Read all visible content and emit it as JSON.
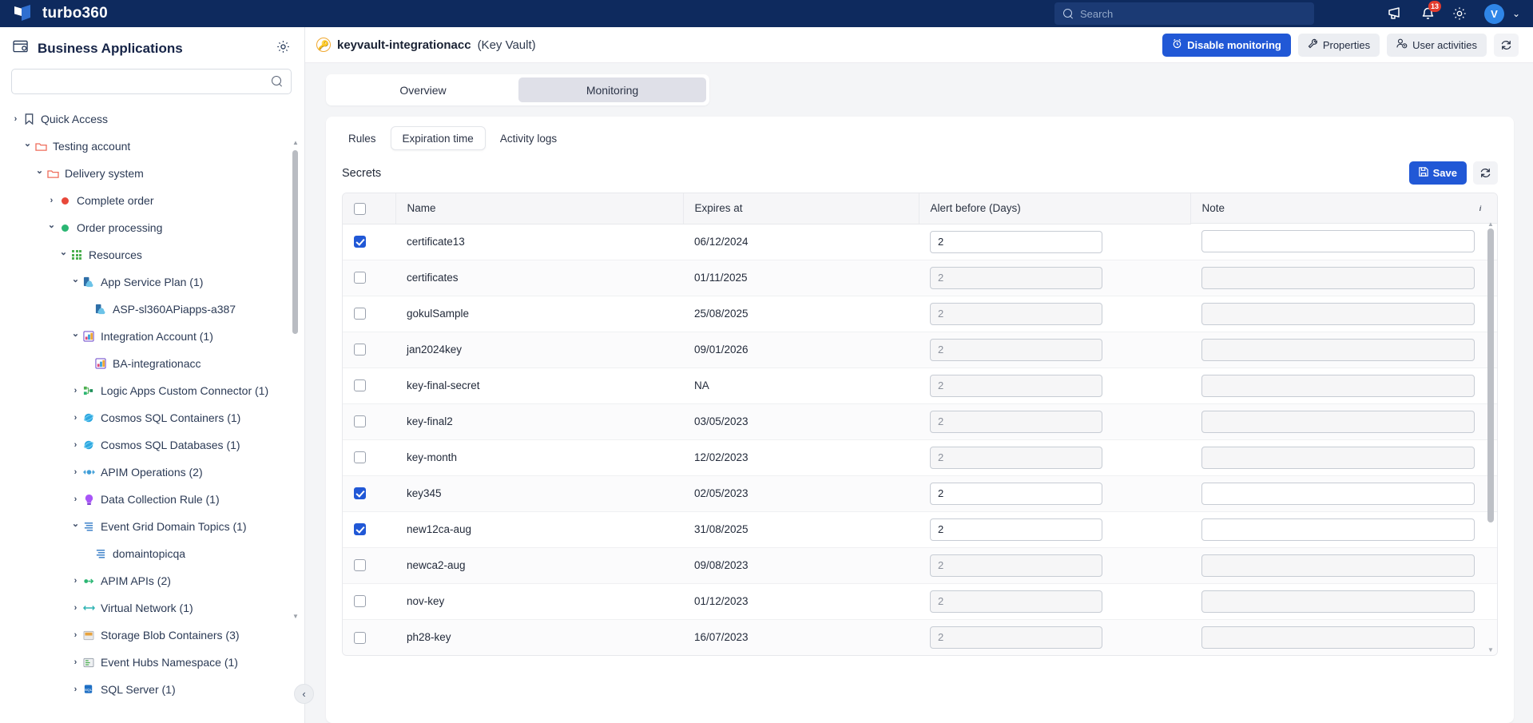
{
  "topbar": {
    "brand": "turbo360",
    "search_placeholder": "Search",
    "icons": {
      "announcement": "megaphone-icon",
      "notifications": "bell-icon",
      "settings": "gear-icon"
    },
    "notification_count": "13",
    "avatar_initial": "V",
    "avatar_chevron": "⌄"
  },
  "sidebar": {
    "title": "Business Applications",
    "search_placeholder": "",
    "search_value": "",
    "tree": [
      {
        "label": "Quick Access",
        "indent": 0,
        "arrow": "closed",
        "icon": "bookmark",
        "color": "#3c4a63"
      },
      {
        "label": "Testing account",
        "indent": 1,
        "arrow": "open",
        "icon": "folder",
        "color": "#ef6c5a"
      },
      {
        "label": "Delivery system",
        "indent": 2,
        "arrow": "open",
        "icon": "folder",
        "color": "#ef6c5a"
      },
      {
        "label": "Complete order",
        "indent": 3,
        "arrow": "closed",
        "icon": "dot",
        "color": "#e8483a"
      },
      {
        "label": "Order processing",
        "indent": 3,
        "arrow": "open",
        "icon": "dot",
        "color": "#2bb673"
      },
      {
        "label": "Resources",
        "indent": 4,
        "arrow": "open",
        "icon": "grid",
        "color": "#4caf50"
      },
      {
        "label": "App Service Plan (1)",
        "indent": 5,
        "arrow": "open",
        "icon": "appservice",
        "color": "#3f9ed8"
      },
      {
        "label": "ASP-sl360APiapps-a387",
        "indent": 6,
        "arrow": "none",
        "icon": "appservice",
        "color": "#3f9ed8"
      },
      {
        "label": "Integration Account (1)",
        "indent": 5,
        "arrow": "open",
        "icon": "intacct",
        "color": "#8a64d6"
      },
      {
        "label": "BA-integrationacc",
        "indent": 6,
        "arrow": "none",
        "icon": "intacct",
        "color": "#8a64d6"
      },
      {
        "label": "Logic Apps Custom Connector (1)",
        "indent": 5,
        "arrow": "closed",
        "icon": "connector",
        "color": "#4caf50"
      },
      {
        "label": "Cosmos SQL Containers (1)",
        "indent": 5,
        "arrow": "closed",
        "icon": "cosmos",
        "color": "#2fa8e0"
      },
      {
        "label": "Cosmos SQL Databases (1)",
        "indent": 5,
        "arrow": "closed",
        "icon": "cosmos",
        "color": "#2fa8e0"
      },
      {
        "label": "APIM Operations (2)",
        "indent": 5,
        "arrow": "closed",
        "icon": "apim",
        "color": "#3f9ed8"
      },
      {
        "label": "Data Collection Rule (1)",
        "indent": 5,
        "arrow": "closed",
        "icon": "bulb",
        "color": "#a855f7"
      },
      {
        "label": "Event Grid Domain Topics (1)",
        "indent": 5,
        "arrow": "open",
        "icon": "eventgrid",
        "color": "#2f78c4"
      },
      {
        "label": "domaintopicqa",
        "indent": 6,
        "arrow": "none",
        "icon": "eventgrid",
        "color": "#2f78c4"
      },
      {
        "label": "APIM APIs (2)",
        "indent": 5,
        "arrow": "closed",
        "icon": "apis",
        "color": "#2bb673"
      },
      {
        "label": "Virtual Network (1)",
        "indent": 5,
        "arrow": "closed",
        "icon": "vnet",
        "color": "#2fb3b3"
      },
      {
        "label": "Storage Blob Containers (3)",
        "indent": 5,
        "arrow": "closed",
        "icon": "blob",
        "color": "#e8a33d"
      },
      {
        "label": "Event Hubs Namespace (1)",
        "indent": 5,
        "arrow": "closed",
        "icon": "eventhubs",
        "color": "#4caf50"
      },
      {
        "label": "SQL Server (1)",
        "indent": 5,
        "arrow": "closed",
        "icon": "sqlserver",
        "color": "#1e6fc4"
      }
    ],
    "collapse_chevron": "‹"
  },
  "page": {
    "title": "keyvault-integrationacc",
    "subtitle": "(Key Vault)",
    "actions": {
      "disable_monitoring": "Disable monitoring",
      "properties": "Properties",
      "user_activities": "User activities",
      "refresh": "refresh-icon"
    }
  },
  "tabs": {
    "items": [
      {
        "label": "Overview",
        "active": false
      },
      {
        "label": "Monitoring",
        "active": true
      }
    ]
  },
  "subtabs": {
    "items": [
      {
        "label": "Rules",
        "active": false
      },
      {
        "label": "Expiration time",
        "active": true
      },
      {
        "label": "Activity logs",
        "active": false
      }
    ]
  },
  "section": {
    "title": "Secrets",
    "save_label": "Save",
    "refresh_label": "refresh-icon"
  },
  "table": {
    "columns": [
      "",
      "Name",
      "Expires at",
      "Alert before (Days)",
      "Note"
    ],
    "note_info_icon": "info-icon",
    "rows": [
      {
        "checked": true,
        "name": "certificate13",
        "expires": "06/12/2024",
        "alert": "2",
        "note": ""
      },
      {
        "checked": false,
        "name": "certificates",
        "expires": "01/11/2025",
        "alert": "2",
        "note": ""
      },
      {
        "checked": false,
        "name": "gokulSample",
        "expires": "25/08/2025",
        "alert": "2",
        "note": ""
      },
      {
        "checked": false,
        "name": "jan2024key",
        "expires": "09/01/2026",
        "alert": "2",
        "note": ""
      },
      {
        "checked": false,
        "name": "key-final-secret",
        "expires": "NA",
        "alert": "2",
        "note": ""
      },
      {
        "checked": false,
        "name": "key-final2",
        "expires": "03/05/2023",
        "alert": "2",
        "note": ""
      },
      {
        "checked": false,
        "name": "key-month",
        "expires": "12/02/2023",
        "alert": "2",
        "note": ""
      },
      {
        "checked": true,
        "name": "key345",
        "expires": "02/05/2023",
        "alert": "2",
        "note": ""
      },
      {
        "checked": true,
        "name": "new12ca-aug",
        "expires": "31/08/2025",
        "alert": "2",
        "note": ""
      },
      {
        "checked": false,
        "name": "newca2-aug",
        "expires": "09/08/2023",
        "alert": "2",
        "note": ""
      },
      {
        "checked": false,
        "name": "nov-key",
        "expires": "01/12/2023",
        "alert": "2",
        "note": ""
      },
      {
        "checked": false,
        "name": "ph28-key",
        "expires": "16/07/2023",
        "alert": "2",
        "note": ""
      }
    ]
  },
  "colors": {
    "header_blue": "#0e2a5e",
    "accent_blue": "#2158d6",
    "avatar_blue": "#2f86e8",
    "badge_red": "#e23b2e",
    "status_green": "#2bb673",
    "status_red": "#e8483a"
  }
}
